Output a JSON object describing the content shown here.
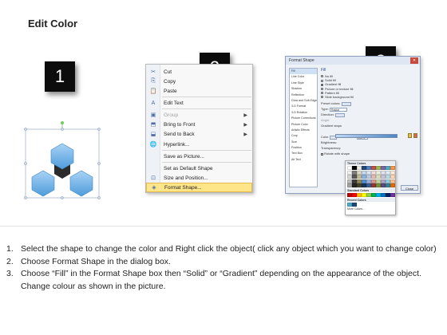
{
  "page": {
    "title": "Edit Color"
  },
  "steps": [
    "1",
    "2",
    "3"
  ],
  "context_menu": {
    "items": [
      {
        "icon": "✂",
        "icon_name": "scissors-icon",
        "label": "Cut",
        "disabled": false,
        "submenu": false
      },
      {
        "icon": "⎘",
        "icon_name": "copy-icon",
        "label": "Copy",
        "disabled": false,
        "submenu": false
      },
      {
        "icon": "📋",
        "icon_name": "paste-icon",
        "label": "Paste",
        "disabled": false,
        "submenu": false
      },
      {
        "icon": "A",
        "icon_name": "edit-text-icon",
        "label": "Edit Text",
        "disabled": false,
        "submenu": false
      },
      {
        "icon": "▣",
        "icon_name": "group-icon",
        "label": "Group",
        "disabled": true,
        "submenu": true
      },
      {
        "icon": "⬒",
        "icon_name": "bring-to-front-icon",
        "label": "Bring to Front",
        "disabled": false,
        "submenu": true
      },
      {
        "icon": "⬓",
        "icon_name": "send-to-back-icon",
        "label": "Send to Back",
        "disabled": false,
        "submenu": true
      },
      {
        "icon": "🌐",
        "icon_name": "hyperlink-icon",
        "label": "Hyperlink...",
        "disabled": false,
        "submenu": false
      },
      {
        "icon": "",
        "icon_name": "",
        "label": "Save as Picture...",
        "disabled": false,
        "submenu": false
      },
      {
        "icon": "",
        "icon_name": "",
        "label": "Set as Default Shape",
        "disabled": false,
        "submenu": false
      },
      {
        "icon": "⊡",
        "icon_name": "size-position-icon",
        "label": "Size and Position...",
        "disabled": false,
        "submenu": false
      },
      {
        "icon": "◈",
        "icon_name": "format-shape-icon",
        "label": "Format Shape...",
        "disabled": false,
        "submenu": false,
        "highlighted": true
      }
    ]
  },
  "dialog": {
    "title": "Format Shape",
    "close_label": "Close",
    "nav": [
      "Fill",
      "Line Color",
      "Line Style",
      "Shadow",
      "Reflection",
      "Glow and Soft Edges",
      "3-D Format",
      "3-D Rotation",
      "Picture Corrections",
      "Picture Color",
      "Artistic Effects",
      "Crop",
      "Size",
      "Position",
      "Text Box",
      "Alt Text"
    ],
    "fill_heading": "Fill",
    "fill_options": [
      {
        "label": "No fill",
        "selected": false
      },
      {
        "label": "Solid fill",
        "selected": false
      },
      {
        "label": "Gradient fill",
        "selected": true
      },
      {
        "label": "Picture or texture fill",
        "selected": false
      },
      {
        "label": "Pattern fill",
        "selected": false
      },
      {
        "label": "Slide background fill",
        "selected": false
      }
    ],
    "preset_label": "Preset colors:",
    "type_label": "Type:",
    "type_value": "Radial",
    "direction_label": "Direction:",
    "angle_label": "Angle:",
    "gradient_stops_label": "Gradient stops",
    "color_label": "Color",
    "position_label": "Position:",
    "position_value": "100%",
    "brightness_label": "Brightness:",
    "transparency_label": "Transparency:",
    "rotate_label": "Rotate with shape"
  },
  "picker": {
    "theme_label": "Theme Colors",
    "standard_label": "Standard Colors",
    "recent_label": "Recent Colors",
    "more_label": "More Colors...",
    "theme_colors": [
      "#ffffff",
      "#000000",
      "#eeece1",
      "#1f497d",
      "#4f81bd",
      "#c0504d",
      "#9bbb59",
      "#8064a2",
      "#4bacc6",
      "#f79646",
      "#f2f2f2",
      "#7f7f7f",
      "#ddd9c3",
      "#c6d9f0",
      "#dbe5f1",
      "#f2dcdb",
      "#ebf1dd",
      "#e5e0ec",
      "#dbeef3",
      "#fdeada",
      "#d8d8d8",
      "#595959",
      "#c4bd97",
      "#8db3e2",
      "#b8cce4",
      "#e5b9b7",
      "#d7e3bc",
      "#ccc1d9",
      "#b7dde8",
      "#fbd5b5",
      "#bfbfbf",
      "#3f3f3f",
      "#938953",
      "#548dd4",
      "#95b3d7",
      "#d99694",
      "#c3d69b",
      "#b2a2c7",
      "#92cddc",
      "#fac08f",
      "#a5a5a5",
      "#262626",
      "#494429",
      "#17365d",
      "#366092",
      "#953734",
      "#76923c",
      "#5f497a",
      "#31859b",
      "#e36c09"
    ],
    "standard_colors": [
      "#c00000",
      "#ff0000",
      "#ffc000",
      "#ffff00",
      "#92d050",
      "#00b050",
      "#00b0f0",
      "#0070c0",
      "#002060",
      "#7030a0"
    ],
    "recent_colors": [
      "#4bacc6",
      "#1f497d"
    ]
  },
  "instructions": [
    {
      "num": "1.",
      "text": "Select the shape to change the color and Right click the object( click any object which you want to change color)"
    },
    {
      "num": "2.",
      "text": "Choose Format Shape in the dialog box."
    },
    {
      "num": "3.",
      "text": "Choose “Fill” in the Format Shape box then “Solid” or “Gradient” depending on the appearance of the object. Change colour as shown in the picture."
    }
  ]
}
